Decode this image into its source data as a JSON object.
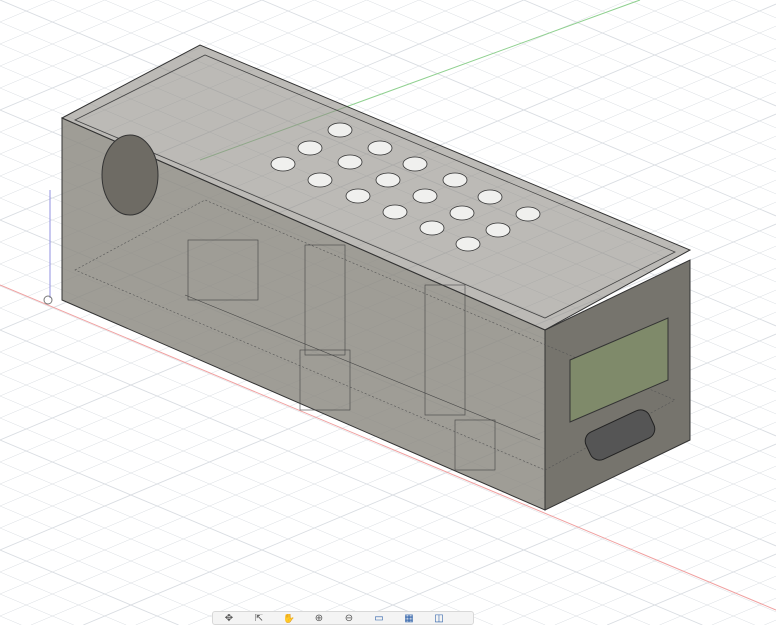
{
  "viewport": {
    "background": "#ffffff",
    "grid_color": "#d9dde2",
    "body_color": "#7d7a72"
  },
  "toolbar": {
    "items": [
      {
        "icon": "orbit-icon",
        "glyph": "✥"
      },
      {
        "icon": "look-at-icon",
        "glyph": "⇱"
      },
      {
        "icon": "pan-icon",
        "glyph": "✋"
      },
      {
        "icon": "zoom-icon",
        "glyph": "⊕"
      },
      {
        "icon": "zoom-window-icon",
        "glyph": "⊖"
      },
      {
        "icon": "display-settings-icon",
        "glyph": "▭"
      },
      {
        "icon": "grid-settings-icon",
        "glyph": "▦"
      },
      {
        "icon": "viewports-icon",
        "glyph": "◫"
      }
    ]
  }
}
